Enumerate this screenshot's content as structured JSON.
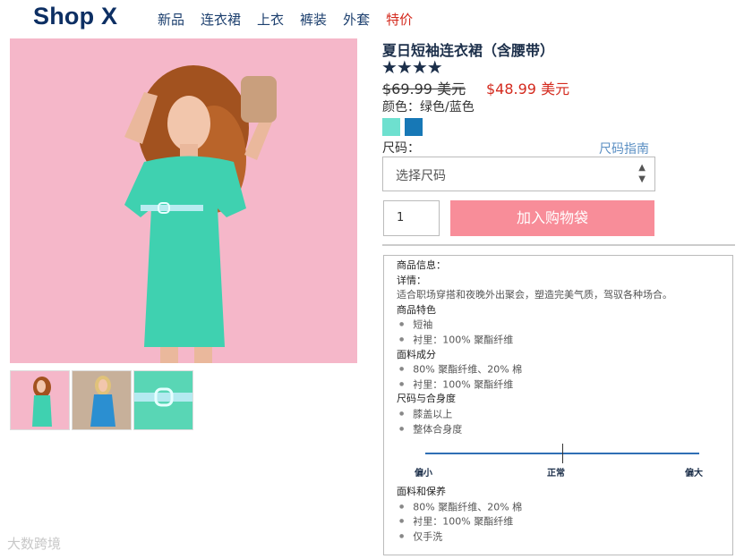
{
  "header": {
    "logo": "Shop X",
    "nav": [
      {
        "label": "新品"
      },
      {
        "label": "连衣裙"
      },
      {
        "label": "上衣"
      },
      {
        "label": "裤装"
      },
      {
        "label": "外套"
      },
      {
        "label": "特价"
      }
    ]
  },
  "product": {
    "title": "夏日短袖连衣裙（含腰带）",
    "stars": "★★★★",
    "rating": 4,
    "price_old": "$69.99 美元",
    "price_new": "$48.99 美元",
    "color_label": "颜色：绿色/蓝色",
    "swatches": [
      {
        "name": "green",
        "color": "#6ee0cf"
      },
      {
        "name": "blue",
        "color": "#1778b6"
      }
    ],
    "size_label": "尺码：",
    "size_guide": "尺码指南",
    "size_placeholder": "选择尺码",
    "quantity": "1",
    "add_to_bag": "加入购物袋"
  },
  "info": {
    "heading": "商品信息：",
    "details_label": "详情：",
    "details_text": "适合职场穿搭和夜晚外出聚会，塑造完美气质，驾驭各种场合。",
    "features_label": "商品特色",
    "features": [
      "短袖",
      "衬里：100% 聚酯纤维"
    ],
    "fabric_label": "面料成分",
    "fabric": [
      "80% 聚酯纤维、20% 棉",
      "衬里：100% 聚酯纤维"
    ],
    "fit_label": "尺码与合身度",
    "fit": [
      "膝盖以上",
      "整体合身度"
    ],
    "fit_scale": {
      "small": "偏小",
      "normal": "正常",
      "large": "偏大",
      "value": 0.5
    },
    "care_label": "面料和保养",
    "care": [
      "80% 聚酯纤维、20% 棉",
      "衬里：100% 聚酯纤维",
      "仅手洗"
    ]
  },
  "watermark": "大数跨境"
}
